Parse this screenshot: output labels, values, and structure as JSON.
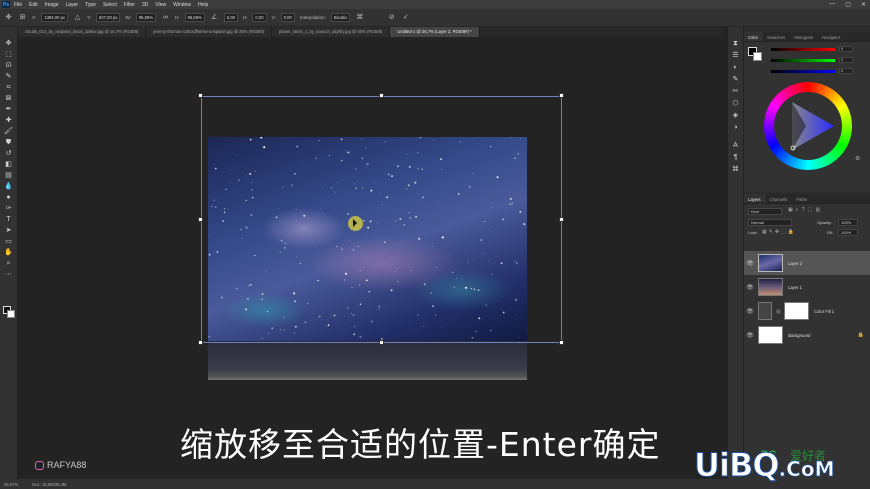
{
  "menu": {
    "app_icon": "Ps",
    "items": [
      "File",
      "Edit",
      "Image",
      "Layer",
      "Type",
      "Select",
      "Filter",
      "3D",
      "View",
      "Window",
      "Help"
    ],
    "window_buttons": [
      "—",
      "▢",
      "✕"
    ]
  },
  "options": {
    "x_label": "X:",
    "x_value": "1394,00 px",
    "y_label": "Y:",
    "y_value": "627,00 px",
    "w_label": "W:",
    "w_value": "95,59%",
    "h_label": "H:",
    "h_value": "95,59%",
    "angle_value": "0,00",
    "hskew_label": "H:",
    "hskew_value": "0,00",
    "vskew_label": "V:",
    "vskew_value": "0,00",
    "interpolation_label": "Interpolation:",
    "interpolation_value": "Bicubic"
  },
  "tabs": [
    {
      "label": "clouds_014_by_redpoint_stock_darker.jpg @ 16,7% (RGB/8)"
    },
    {
      "label": "jeremy-thomas-4JdvxdfNmIw-unsplash.jpg @ 25% (RGB/8)"
    },
    {
      "label": "planet_stock_1_by_kanoch_dighlry.jpg @ 50% (RGB/8)"
    },
    {
      "label": "Untitled-1 @ 26,7% (Layer 2, RGB/8#) *"
    }
  ],
  "canvas": {
    "subtitle": "缩放移至合适的位置-Enter确定",
    "brand": "RAFYA88"
  },
  "status": {
    "zoom": "26,67%",
    "doc": "Doc: 15,8M/35,4M"
  },
  "color_panel": {
    "tabs": [
      "Color",
      "Swatches",
      "Histogram",
      "Navigator"
    ],
    "slider_values": [
      "0",
      "0",
      "0"
    ]
  },
  "layers_panel": {
    "tabs": [
      "Layers",
      "Channels",
      "Paths"
    ],
    "search_placeholder": "Kind",
    "blend_mode": "Normal",
    "opacity_label": "Opacity:",
    "opacity_value": "100%",
    "lock_label": "Lock:",
    "fill_label": "Fill:",
    "fill_value": "100%",
    "layers": [
      {
        "name": "Layer 2",
        "selected": true
      },
      {
        "name": "Layer 1",
        "selected": false
      },
      {
        "name": "Color Fill 1",
        "selected": false
      },
      {
        "name": "Background",
        "selected": false
      }
    ]
  },
  "watermark": {
    "main": "UiBQ",
    "suffix": ".CoM",
    "ps_mark": "PS",
    "ps_text": "爱好者"
  }
}
